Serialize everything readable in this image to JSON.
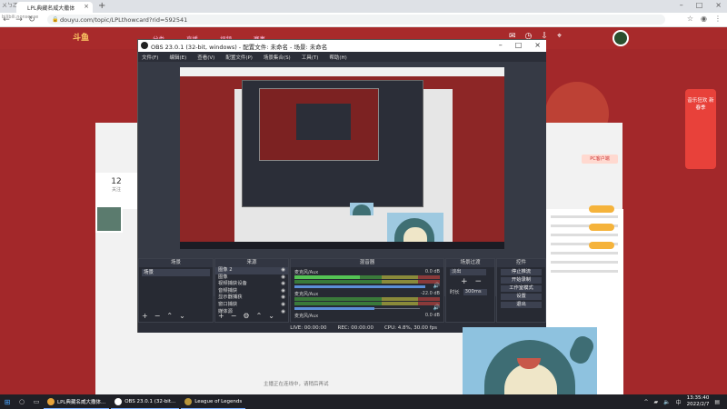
{
  "browser": {
    "tab_title": "LPL典藏名威大撒体",
    "watermark": "ㄨㄅ乙",
    "watermark2": "bilibili.nonsense",
    "url": "douyu.com/topic/LPLthowcard?rid=592541",
    "nav": {
      "back": "←",
      "forward": "→",
      "reload": "↻",
      "home": "⌂"
    }
  },
  "site": {
    "logo": "斗鱼",
    "nav_items": [
      "分类",
      "直播",
      "视频",
      "赛事"
    ],
    "follow_count": "12",
    "follow_label": "关注",
    "pc_button": "PC客户端",
    "gift_label": "音乐狂欢 新春季",
    "bottom_msg": "主播正在连线中，请稍后再试"
  },
  "obs": {
    "title": "OBS 23.0.1 (32-bit, windows) - 配置文件: 未命名 - 场景: 未命名",
    "menu": [
      "文件(F)",
      "编辑(E)",
      "查看(V)",
      "配置文件(P)",
      "场景集合(S)",
      "工具(T)",
      "帮助(H)"
    ],
    "docks": {
      "scenes": {
        "title": "场景",
        "items": [
          "场景"
        ]
      },
      "sources": {
        "title": "来源",
        "items": [
          "图像 2",
          "图像",
          "视频捕获设备",
          "音频捕获",
          "显示器捕获",
          "窗口捕获",
          "媒体源"
        ]
      },
      "mixer": {
        "title": "混音器",
        "channels": [
          {
            "name": "麦克风/Aux",
            "db": "0.0 dB"
          },
          {
            "name": "麦克风/Aux",
            "db": "-22.0 dB"
          },
          {
            "name": "麦克风/Aux",
            "db": "0.0 dB"
          }
        ]
      },
      "transitions": {
        "title": "场景过渡",
        "selected": "淡出",
        "duration_label": "时长",
        "duration_value": "300ms"
      },
      "controls": {
        "title": "控件",
        "buttons": [
          "停止推流",
          "开始录制",
          "工作室模式",
          "设置",
          "退出"
        ]
      }
    },
    "status": {
      "live": "LIVE: 00:00:00",
      "rec": "REC: 00:00:00",
      "cpu": "CPU: 4.8%, 30.00 fps"
    }
  },
  "taskbar": {
    "apps": [
      {
        "label": "LPL典藏名威大撒体...",
        "color": "#e8a33a"
      },
      {
        "label": "OBS 23.0.1 (32-bit...",
        "color": "#2b2e38"
      },
      {
        "label": "League of Legends",
        "color": "#b8953a"
      }
    ],
    "time": "13:35:40",
    "date": "2022/2/7"
  }
}
